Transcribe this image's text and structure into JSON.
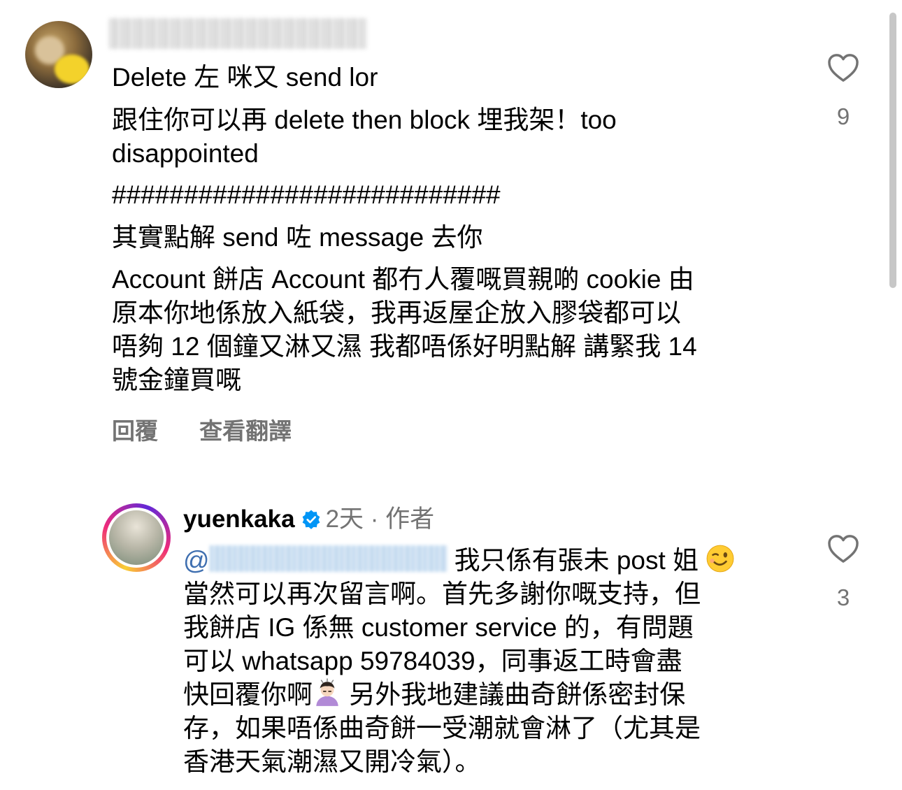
{
  "comment1": {
    "line1": "Delete 左 咪又 send lor",
    "line2": "跟住你可以再 delete then block 埋我架！too\ndisappointed",
    "line3": "###########################",
    "line4": "其實點解 send 咗 message 去你",
    "line5": "Account 餅店 Account 都冇人覆嘅買親啲 cookie 由\n原本你地係放入紙袋，我再返屋企放入膠袋都可以\n唔夠 12 個鐘又淋又濕 我都唔係好明點解 講緊我 14\n號金鐘買嘅",
    "likes": "9",
    "actions": {
      "reply": "回覆",
      "translate": "查看翻譯"
    }
  },
  "reply": {
    "username": "yuenkaka",
    "time": "2天",
    "separator": "·",
    "role": "作者",
    "mention_prefix": "@",
    "text_part1": "我只係有張未 post 姐",
    "text_part2": "當然可以再次留言啊。首先多謝你嘅支持，但\n我餅店 IG 係無 customer service 的，有問題\n可以 whatsapp 59784039，同事返工時會盡\n快回覆你啊",
    "text_part3": " 另外我地建議曲奇餅係密封保\n存，如果唔係曲奇餅一受潮就會淋了（尤其是\n香港天氣潮濕又開冷氣）。",
    "likes": "3",
    "emoji_1": "winking-face-emoji",
    "emoji_2": "person-bowing-emoji"
  },
  "icons": {
    "like": "heart-outline-icon",
    "verified": "verified-badge-icon"
  },
  "colors": {
    "secondary_text": "#737373",
    "verified_blue": "#0095f6"
  }
}
